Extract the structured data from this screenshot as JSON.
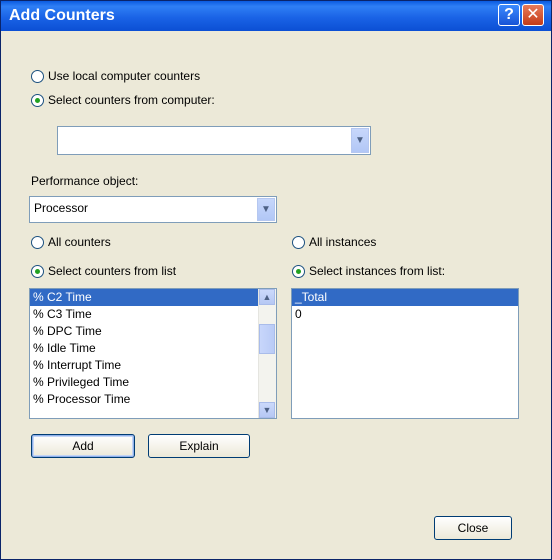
{
  "title": "Add Counters",
  "titlebar": {
    "help_glyph": "?",
    "close_glyph": "✕"
  },
  "source": {
    "option_local": "Use local computer counters",
    "option_remote": "Select counters from computer:",
    "computer_value": "",
    "selected": "remote"
  },
  "performance_object": {
    "label": "Performance object:",
    "value": "Processor"
  },
  "counters": {
    "option_all": "All counters",
    "option_list": "Select counters from list",
    "items": [
      "% C2 Time",
      "% C3 Time",
      "% DPC Time",
      "% Idle Time",
      "% Interrupt Time",
      "% Privileged Time",
      "% Processor Time"
    ],
    "selected_index": 0
  },
  "instances": {
    "option_all": "All instances",
    "option_list": "Select instances from list:",
    "items": [
      "_Total",
      "0"
    ],
    "selected_index": 0
  },
  "buttons": {
    "add": "Add",
    "explain": "Explain",
    "close": "Close"
  }
}
